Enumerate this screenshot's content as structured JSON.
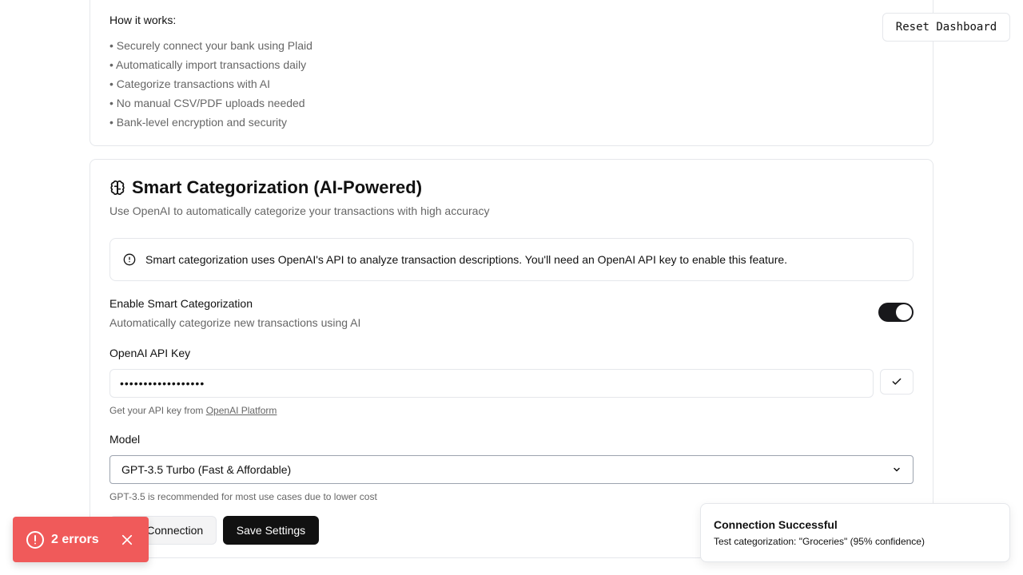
{
  "how_it_works": {
    "title": "How it works:",
    "items": [
      "• Securely connect your bank using Plaid",
      "• Automatically import transactions daily",
      "• Categorize transactions with AI",
      "• No manual CSV/PDF uploads needed",
      "• Bank-level encryption and security"
    ]
  },
  "smart": {
    "title": "Smart Categorization (AI-Powered)",
    "subtitle": "Use OpenAI to automatically categorize your transactions with high accuracy",
    "alert": "Smart categorization uses OpenAI's API to analyze transaction descriptions. You'll need an OpenAI API key to enable this feature.",
    "toggle_label": "Enable Smart Categorization",
    "toggle_desc": "Automatically categorize new transactions using AI",
    "toggle_on": true,
    "api_key_label": "OpenAI API Key",
    "api_key_value": "••••••••••••••••••",
    "api_help_prefix": "Get your API key from ",
    "api_help_link": "OpenAI Platform",
    "model_label": "Model",
    "model_selected": "GPT-3.5 Turbo (Fast & Affordable)",
    "model_help": "GPT-3.5 is recommended for most use cases due to lower cost",
    "test_button": "Test Connection",
    "save_button": "Save Settings"
  },
  "reset_button": "Reset Dashboard",
  "toast": {
    "title": "Connection Successful",
    "body": "Test categorization: \"Groceries\" (95% confidence)"
  },
  "errors_badge": {
    "label": "2 errors",
    "color": "#f05a5a"
  },
  "icons": [
    "brain-icon",
    "info-icon",
    "check-icon",
    "chevron-down-icon",
    "alert-circle-icon",
    "close-icon"
  ]
}
